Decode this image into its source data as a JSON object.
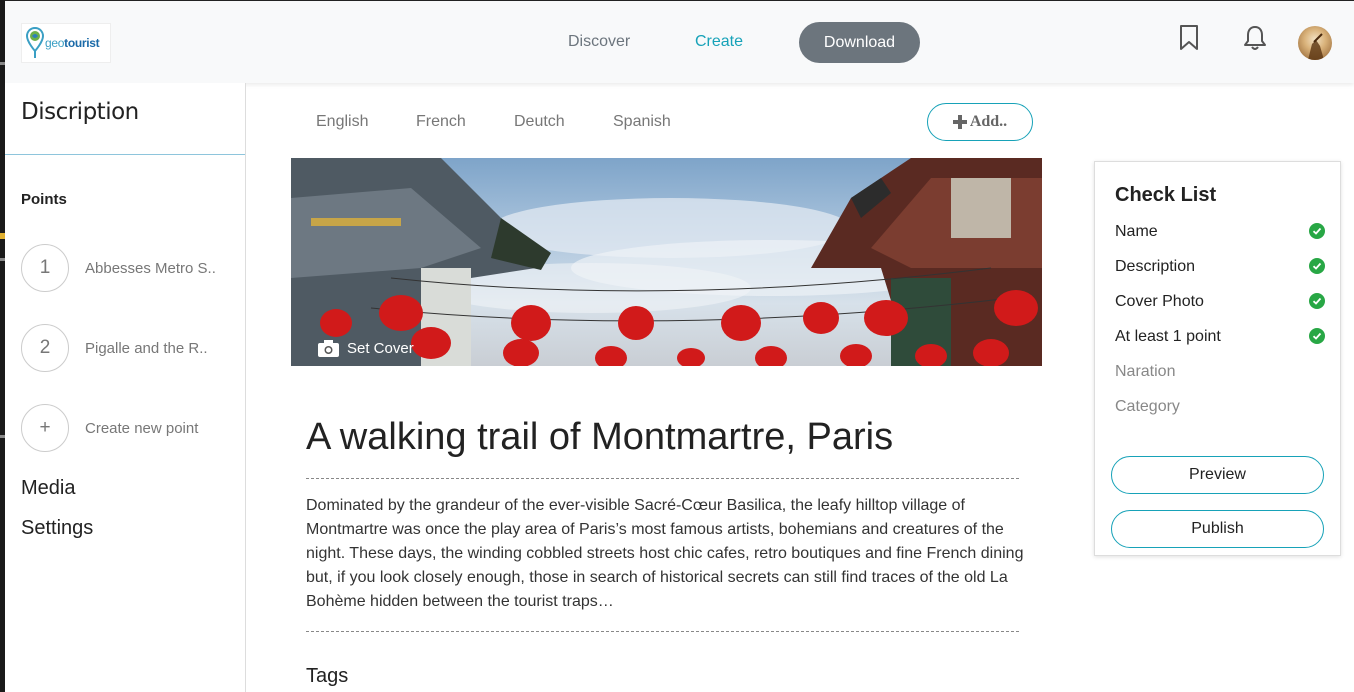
{
  "header": {
    "logo": {
      "text_light": "geo",
      "text_bold": "tourist"
    },
    "nav": {
      "discover": "Discover",
      "create": "Create",
      "download": "Download"
    },
    "icons": {
      "bookmark": "bookmark-icon",
      "notifications": "bell-icon",
      "avatar": "user-avatar"
    }
  },
  "sidebar": {
    "title": "Discription",
    "points_heading": "Points",
    "points": [
      {
        "number": "1",
        "label": "Abbesses Metro S.."
      },
      {
        "number": "2",
        "label": "Pigalle and the R.."
      }
    ],
    "create_point": {
      "icon": "+",
      "label": "Create new point"
    },
    "media": "Media",
    "settings": "Settings"
  },
  "main": {
    "languages": [
      "English",
      "French",
      "Deutch",
      "Spanish"
    ],
    "add_button": "Add..",
    "cover": {
      "set_cover_label": "Set Cover",
      "icon": "camera-icon"
    },
    "title": "A walking trail of Montmartre, Paris",
    "description": "Dominated by the grandeur of the ever-visible Sacré-Cœur Basilica, the leafy hilltop village of Montmartre was once the play area of Paris’s most famous artists, bohemians and creatures of the night. These days, the winding cobbled streets host chic cafes, retro boutiques and fine French dining but, if you look closely enough, those in search of historical secrets can still find traces of the old La Bohème hidden between the tourist traps…",
    "tags_heading": "Tags"
  },
  "checklist": {
    "title": "Check List",
    "items": [
      {
        "label": "Name",
        "done": true
      },
      {
        "label": "Description",
        "done": true
      },
      {
        "label": "Cover Photo",
        "done": true
      },
      {
        "label": "At least 1 point",
        "done": true
      },
      {
        "label": "Naration",
        "done": false
      },
      {
        "label": "Category",
        "done": false
      }
    ],
    "preview_button": "Preview",
    "publish_button": "Publish"
  },
  "colors": {
    "accent": "#17a2b8",
    "check": "#28a745",
    "download_bg": "#6c757d"
  }
}
